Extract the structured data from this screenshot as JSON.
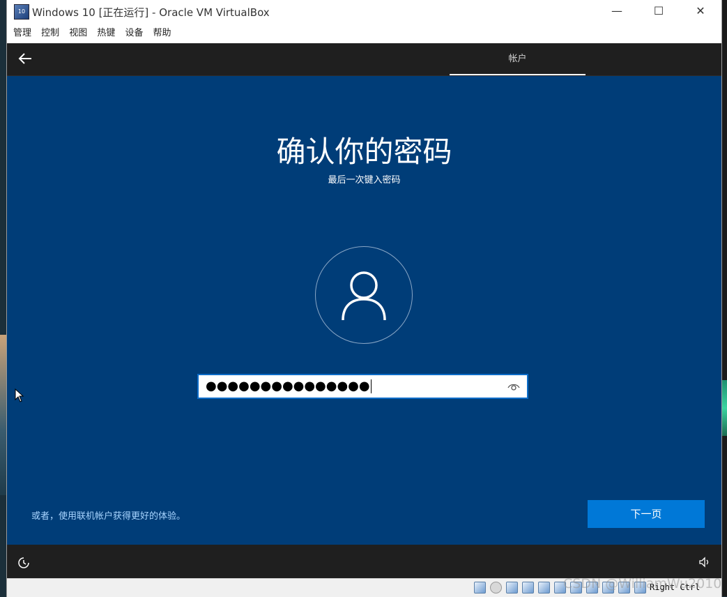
{
  "window": {
    "title": "Windows 10 [正在运行] - Oracle VM VirtualBox",
    "app_icon_text": "10",
    "controls": {
      "minimize": "—",
      "maximize": "☐",
      "close": "✕"
    }
  },
  "menubar": {
    "items": [
      "管理",
      "控制",
      "视图",
      "热键",
      "设备",
      "帮助"
    ]
  },
  "oobe": {
    "tab_label": "帐户",
    "heading": "确认你的密码",
    "subheading": "最后一次键入密码",
    "password_value": "●●●●●●●●●●●●●●●",
    "alt_link": "或者，使用联机帐户获得更好的体验。",
    "next_button": "下一页"
  },
  "statusbar": {
    "host_key": "Right Ctrl"
  },
  "watermark": "CSDN @WilliamWu2010",
  "colors": {
    "oobe_blue": "#003d78",
    "accent": "#0078d7",
    "link": "#a8d4ff"
  },
  "icons": {
    "back": "back-arrow-icon",
    "avatar": "user-icon",
    "reveal": "eye-icon",
    "accessibility": "accessibility-icon",
    "volume": "volume-icon"
  }
}
